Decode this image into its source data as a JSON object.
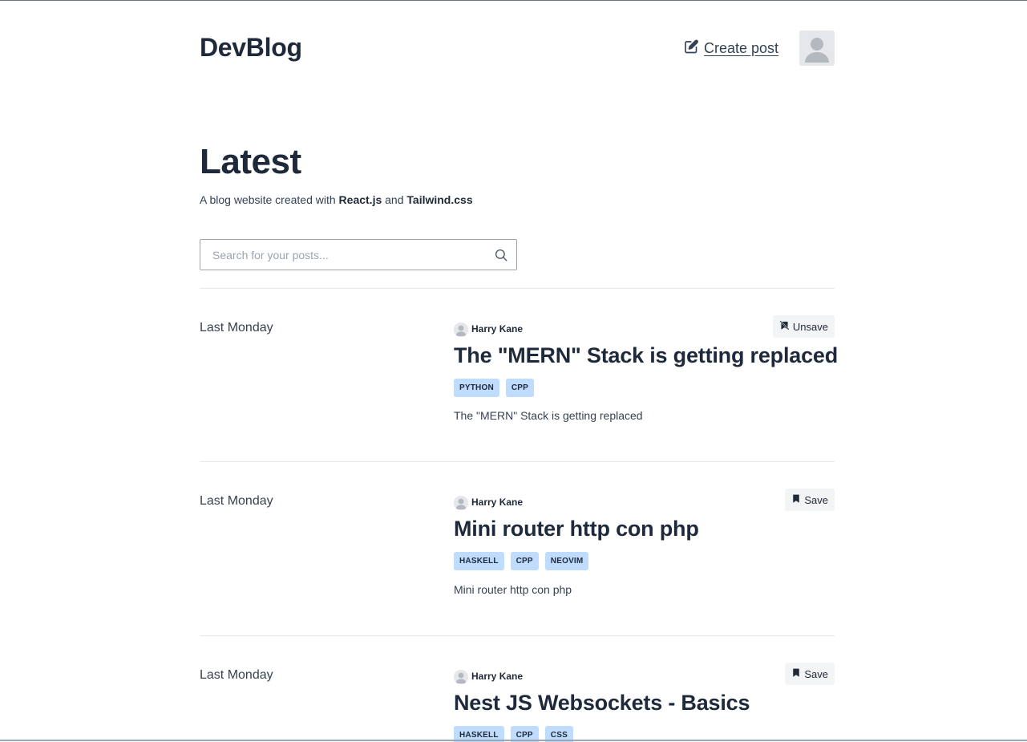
{
  "header": {
    "brand": "DevBlog",
    "create_post_label": "Create post",
    "pencil_icon": "edit-icon",
    "avatar_icon": "user-avatar-icon"
  },
  "hero": {
    "title": "Latest",
    "subtitle_prefix": "A blog website created with ",
    "subtitle_react": "React.js",
    "subtitle_and": " and ",
    "subtitle_tailwind": "Tailwind.css"
  },
  "search": {
    "placeholder": "Search for your posts...",
    "value": "",
    "icon": "search-icon"
  },
  "colors": {
    "text_dark": "#1e293b",
    "tag_bg": "#bfdbfe",
    "save_bg": "#f3f4f6",
    "divider": "#e5e7eb"
  },
  "posts": [
    {
      "date": "Last Monday",
      "author": "Harry Kane",
      "save_label": "Unsave",
      "save_icon": "bookmark-slash-icon",
      "title": "The \"MERN\" Stack is getting replaced",
      "tags": [
        "PYTHON",
        "CPP"
      ],
      "excerpt": "The \"MERN\" Stack is getting replaced"
    },
    {
      "date": "Last Monday",
      "author": "Harry Kane",
      "save_label": "Save",
      "save_icon": "bookmark-icon",
      "title": "Mini router http con php",
      "tags": [
        "HASKELL",
        "CPP",
        "NEOVIM"
      ],
      "excerpt": "Mini router http con php"
    },
    {
      "date": "Last Monday",
      "author": "Harry Kane",
      "save_label": "Save",
      "save_icon": "bookmark-icon",
      "title": "Nest JS Websockets - Basics",
      "tags": [
        "HASKELL",
        "CPP",
        "CSS"
      ],
      "excerpt": ""
    }
  ]
}
